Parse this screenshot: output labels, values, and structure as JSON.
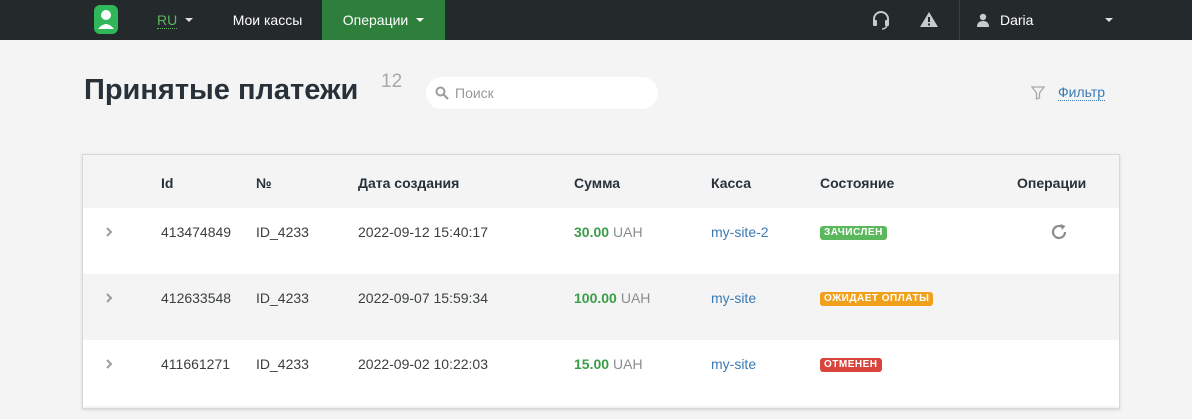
{
  "nav": {
    "lang": "RU",
    "kassy": "Мои кассы",
    "operations": "Операции",
    "user": "Daria",
    "icons": [
      "user-logo-icon",
      "headset-icon",
      "warning-icon",
      "user-icon",
      "chevron-down-icon"
    ]
  },
  "page": {
    "title": "Принятые платежи",
    "count": "12",
    "search_placeholder": "Поиск",
    "filter": "Фильтр"
  },
  "table": {
    "headers": {
      "id": "Id",
      "num": "№",
      "date": "Дата создания",
      "sum": "Сумма",
      "kassa": "Касса",
      "state": "Состояние",
      "ops": "Операции"
    },
    "rows": [
      {
        "id": "413474849",
        "num": "ID_4233",
        "date": "2022-09-12 15:40:17",
        "amount": "30.00",
        "currency": "UAH",
        "kassa": "my-site-2",
        "status": "ЗАЧИСЛЕН",
        "status_color": "#5cb85c",
        "has_refresh": true
      },
      {
        "id": "412633548",
        "num": "ID_4233",
        "date": "2022-09-07 15:59:34",
        "amount": "100.00",
        "currency": "UAH",
        "kassa": "my-site",
        "status": "ОЖИДАЕТ ОПЛАТЫ",
        "status_color": "#f0a01a",
        "has_refresh": false
      },
      {
        "id": "411661271",
        "num": "ID_4233",
        "date": "2022-09-02 10:22:03",
        "amount": "15.00",
        "currency": "UAH",
        "kassa": "my-site",
        "status": "ОТМЕНЕН",
        "status_color": "#d9443c",
        "has_refresh": false
      }
    ]
  },
  "colors": {
    "navbar": "#24292b",
    "nav_active": "#2f7f3c",
    "accent_green": "#3a9d47",
    "link_blue": "#3a7ab5"
  }
}
